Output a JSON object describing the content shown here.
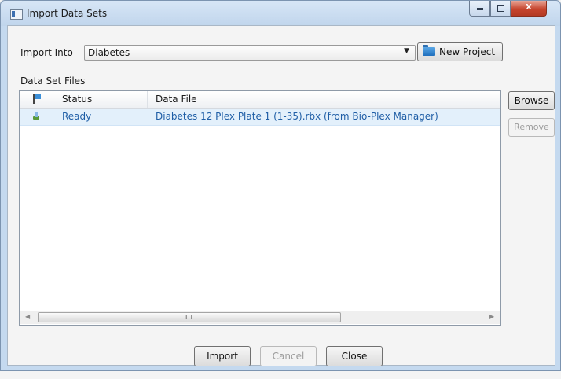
{
  "window": {
    "title": "Import Data Sets",
    "minimize_glyph": "",
    "maximize_glyph": "",
    "close_glyph": "X"
  },
  "import_into": {
    "label": "Import Into",
    "selected": "Diabetes",
    "dropdown_arrow": "▼",
    "new_project_label": "New Project"
  },
  "data_set_files": {
    "label": "Data Set Files",
    "columns": [
      "",
      "Status",
      "Data File"
    ],
    "rows": [
      {
        "status": "Ready",
        "file": "Diabetes 12 Plex Plate 1 (1-35).rbx (from Bio-Plex Manager)"
      }
    ],
    "scroll_left": "◀",
    "scroll_right": "▶",
    "scroll_grip": "III"
  },
  "side_buttons": {
    "browse": "Browse",
    "remove": "Remove"
  },
  "footer": {
    "import": "Import",
    "cancel": "Cancel",
    "close": "Close"
  },
  "colors": {
    "selection": "#e3f0fb",
    "link_text": "#1f5ea6",
    "frame": "#c4d9ef"
  },
  "icons": [
    "app-icon",
    "flag-icon",
    "ready-icon",
    "folder-icon"
  ]
}
